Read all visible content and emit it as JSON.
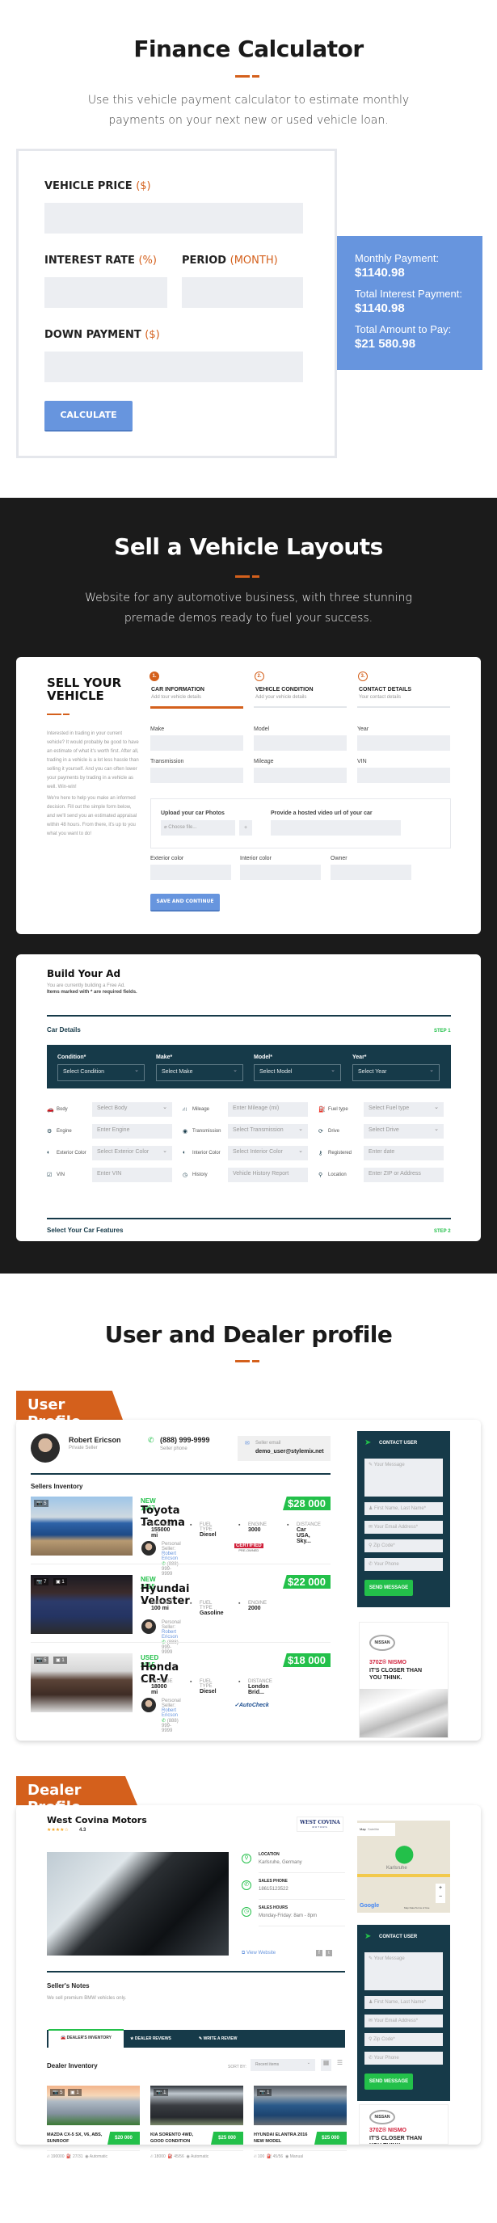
{
  "finance": {
    "title": "Finance Calculator",
    "lead": "Use this vehicle payment calculator to estimate monthly payments on your next new or used vehicle loan.",
    "fields": {
      "vehicle_price": {
        "label": "VEHICLE PRICE",
        "unit": "($)",
        "value": ""
      },
      "interest_rate": {
        "label": "INTEREST RATE",
        "unit": "(%)",
        "value": ""
      },
      "period": {
        "label": "PERIOD",
        "unit": "(MONTH)",
        "value": ""
      },
      "down_payment": {
        "label": "DOWN PAYMENT",
        "unit": "($)",
        "value": ""
      }
    },
    "calculate_label": "CALCULATE",
    "results": {
      "monthly_label": "Monthly Payment:",
      "monthly_value": "$1140.98",
      "interest_label": "Total Interest Payment:",
      "interest_value": "$1140.98",
      "total_label": "Total Amount to Pay:",
      "total_value": "$21 580.98"
    },
    "accent": "#d4601c",
    "button_color": "#6795de"
  },
  "sell": {
    "title": "Sell a Vehicle Layouts",
    "lead": "Website for any automotive business, with three stunning premade demos ready to fuel your success.",
    "form1": {
      "heading": "SELL YOUR VEHICLE",
      "para1": "Interested in trading in your current vehicle? It would probably be good to have an estimate of what it's worth first. After all, trading in a vehicle is a lot less hassle than selling it yourself. And you can often lower your payments by trading in a vehicle as well. Win-win!",
      "para2": "We're here to help you make an informed decision. Fill out the simple form below, and we'll send you an estimated appraisal within 48 hours. From there, it's up to you what you want to do!",
      "steps": [
        {
          "num": "1.",
          "title": "CAR INFORMATION",
          "sub": "Add tour vehicle details"
        },
        {
          "num": "2.",
          "title": "VEHICLE CONDITION",
          "sub": "Add your vehicle details"
        },
        {
          "num": "3.",
          "title": "CONTACT DETAILS",
          "sub": "Your contact details"
        }
      ],
      "fields": [
        "Make",
        "Model",
        "Year",
        "Transmission",
        "Mileage",
        "VIN"
      ],
      "upload_label": "Upload your car Photos",
      "upload_placeholder": "Choose file...",
      "upload_plus": "+",
      "video_label": "Provide a hosted video url of your car",
      "fields2": [
        "Exterior color",
        "Interior color",
        "Owner"
      ],
      "save_label": "SAVE AND CONTINUE"
    },
    "form2": {
      "heading": "Build Your Ad",
      "sub1": "You are currently building a Free Ad.",
      "sub2": "Items marked with * are required fields.",
      "section1": "Car Details",
      "step1": "STEP 1",
      "selects": [
        {
          "label": "Condition*",
          "value": "Select Condition"
        },
        {
          "label": "Make*",
          "value": "Select Make"
        },
        {
          "label": "Model*",
          "value": "Select Model"
        },
        {
          "label": "Year*",
          "value": "Select Year"
        }
      ],
      "rows": [
        {
          "icon": "car-body-icon",
          "label": "Body",
          "ph": "Select Body",
          "select": true
        },
        {
          "icon": "road-icon",
          "label": "Mileage",
          "ph": "Enter Mileage (mi)",
          "select": false
        },
        {
          "icon": "fuel-icon",
          "label": "Fuel type",
          "ph": "Select Fuel type",
          "select": true
        },
        {
          "icon": "engine-icon",
          "label": "Engine",
          "ph": "Enter Engine",
          "select": false
        },
        {
          "icon": "transmission-icon",
          "label": "Transmission",
          "ph": "Select Transmission",
          "select": true
        },
        {
          "icon": "drive-icon",
          "label": "Drive",
          "ph": "Select Drive",
          "select": true
        },
        {
          "icon": "color-icon",
          "label": "Exterior Color",
          "ph": "Select Exterior Color",
          "select": true
        },
        {
          "icon": "color-icon",
          "label": "Interior Color",
          "ph": "Select Interior Color",
          "select": true
        },
        {
          "icon": "key-icon",
          "label": "Registered",
          "ph": "Enter date",
          "select": false
        },
        {
          "icon": "vin-icon",
          "label": "VIN",
          "ph": "Enter VIN",
          "select": false
        },
        {
          "icon": "history-icon",
          "label": "History",
          "ph": "Vehicle History Report",
          "select": false
        },
        {
          "icon": "location-icon",
          "label": "Location",
          "ph": "Enter ZIP or Address",
          "select": false
        }
      ],
      "section2": "Select Your Car Features",
      "step2": "STEP 2"
    }
  },
  "profiles": {
    "title": "User and Dealer profile",
    "user": {
      "flag": "User Profile",
      "name": "Robert Ericson",
      "role": "Private Seller",
      "phone": "(888) 999-9999",
      "phone_label": "Seller phone",
      "email_label": "Seller email",
      "email": "demo_user@stylemix.net",
      "inventory_title": "Sellers Inventory",
      "listings": [
        {
          "tag": "NEW 1967",
          "title": "Toyota Tacoma",
          "price": "$28 000",
          "photos": "5",
          "videos": "",
          "specs": [
            {
              "k": "MILEAGE",
              "v": "155000 mi"
            },
            {
              "k": "FUEL TYPE",
              "v": "Diesel"
            },
            {
              "k": "ENGINE",
              "v": "3000"
            },
            {
              "k": "DISTANCE",
              "v": "Car USA, Sky..."
            }
          ],
          "seller_label": "Personal Seller:",
          "seller": "Robert Ericson",
          "seller_phone": "(888) 999-9999",
          "badge": "CERTIFIED",
          "badge_sub": "PRE-OWNED"
        },
        {
          "tag": "NEW 2015",
          "title": "Hyundai Veloster",
          "price": "$22 000",
          "photos": "7",
          "videos": "1",
          "specs": [
            {
              "k": "MILEAGE",
              "v": "100 mi"
            },
            {
              "k": "FUEL TYPE",
              "v": "Gasoline"
            },
            {
              "k": "ENGINE",
              "v": "2000"
            }
          ],
          "seller_label": "Personal Seller:",
          "seller": "Robert Ericson",
          "seller_phone": "(888) 999-9999",
          "badge": "",
          "badge_sub": ""
        },
        {
          "tag": "USED 2015",
          "title": "Honda CR-V",
          "price": "$18 000",
          "photos": "5",
          "videos": "1",
          "specs": [
            {
              "k": "MILEAGE",
              "v": "18000 mi"
            },
            {
              "k": "FUEL TYPE",
              "v": "Diesel"
            },
            {
              "k": "DISTANCE",
              "v": "London Brid..."
            }
          ],
          "seller_label": "Personal Seller:",
          "seller": "Robert Ericson",
          "seller_phone": "(888) 999-9999",
          "badge": "AutoCheck",
          "badge_sub": ""
        }
      ]
    },
    "contact": {
      "title": "CONTACT USER",
      "message_ph": "Your Message",
      "name_ph": "First Name, Last Name*",
      "email_ph": "Your Email Address*",
      "zip_ph": "Zip Code*",
      "phone_ph": "Your Phone",
      "send_label": "SEND MESSAGE"
    },
    "ad": {
      "brand": "NISSAN",
      "line1": "370Z® NISMO",
      "line2": "IT'S CLOSER THAN YOU THINK."
    },
    "dealer": {
      "flag": "Dealer Profile",
      "name": "West Covina Motors",
      "rating": "4.3",
      "rating_value": 4.3,
      "logo_text": "WEST COVINA",
      "logo_sub": "MOTORS",
      "info": [
        {
          "icon": "location-icon",
          "k": "LOCATION",
          "v": "Karlsruhe, Germany"
        },
        {
          "icon": "phone-icon",
          "k": "SALES PHONE",
          "v": "18615123522"
        },
        {
          "icon": "clock-icon",
          "k": "SALES HOURS",
          "v": "Monday-Friday: 8am - 8pm"
        }
      ],
      "website_label": "View Website",
      "notes_title": "Seller's Notes",
      "notes": "We sell premium BMW vehicles only.",
      "tabs": [
        "DEALER'S INVENTORY",
        "DEALER REVIEWS",
        "WRITE A REVIEW"
      ],
      "inventory_title": "Dealer Inventory",
      "sort_label": "SORT BY:",
      "sort_value": "Recent items",
      "map": {
        "tab_map": "Map",
        "tab_sat": "Satellite",
        "city": "Karlsruhe",
        "google": "Google",
        "footer": "Map Data   Terms of Use"
      },
      "cars": [
        {
          "title": "MAZDA CX-5 SX, V6, ABS, SUNROOF",
          "price": "$20 000",
          "photos": "5",
          "videos": "1",
          "mileage": "190000",
          "mpg": "27/31",
          "trans": "Automatic"
        },
        {
          "title": "KIA SORENTO 4WD, GOOD CONDITION",
          "price": "$25 000",
          "photos": "1",
          "videos": "",
          "mileage": "18000",
          "mpg": "45/56",
          "trans": "Automatic"
        },
        {
          "title": "HYUNDAI ELANTRA 2016 NEW MODEL",
          "price": "$25 000",
          "photos": "1",
          "videos": "",
          "mileage": "100",
          "mpg": "45/56",
          "trans": "Manual"
        }
      ]
    },
    "colors": {
      "green": "#23c04a",
      "navy": "#163a49",
      "orange": "#d4601c"
    }
  }
}
